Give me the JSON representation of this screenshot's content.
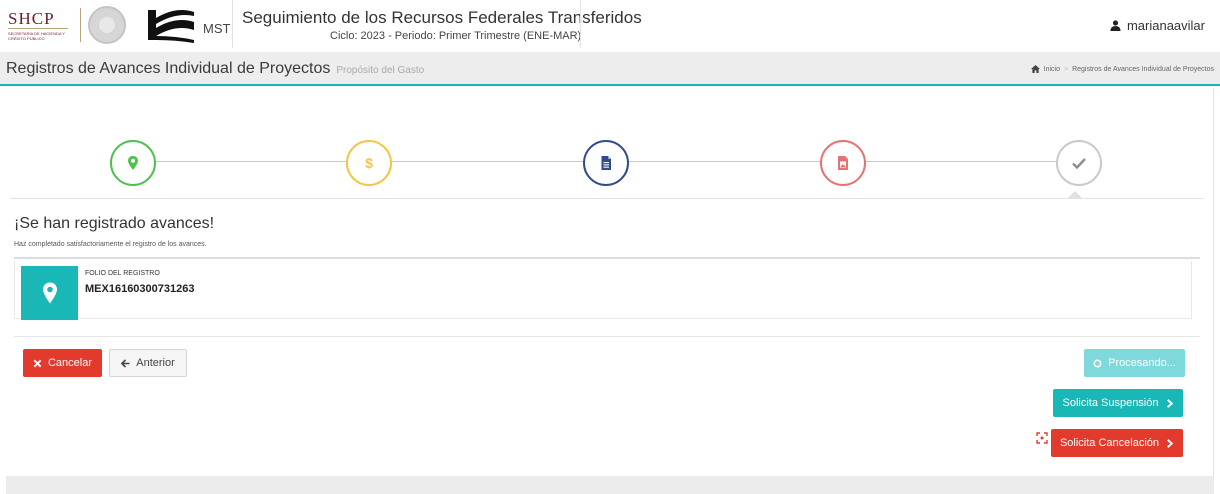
{
  "header": {
    "shcp_logo": {
      "word": "SHCP",
      "sub": "SECRETARÍA DE HACIENDA Y CRÉDITO PÚBLICO"
    },
    "mst_label": "MST",
    "app_title": "Seguimiento de los Recursos Federales Transferidos",
    "cycle": "Ciclo: 2023 - Periodo: Primer Trimestre (ENE-MAR)",
    "username": "marianaavilar"
  },
  "page": {
    "title": "Registros de Avances Individual de Proyectos",
    "subtitle": "Propósito del Gasto",
    "breadcrumb": {
      "home": "Inicio",
      "separator": ">",
      "current": "Registros de Avances Individual de Proyectos"
    }
  },
  "wizard": {
    "steps": [
      {
        "icon": "map-marker-icon",
        "color": "#4cc24c"
      },
      {
        "icon": "dollar-icon",
        "color": "#f5c443"
      },
      {
        "icon": "document-icon",
        "color": "#2e4c8f"
      },
      {
        "icon": "image-icon",
        "color": "#e57373"
      },
      {
        "icon": "check-icon",
        "color": "#9a9a9a",
        "active": true
      }
    ]
  },
  "result": {
    "title": "¡Se han registrado avances!",
    "description": "Haz completado satisfactoriamente el registro de los avances.",
    "folio_label": "FOLIO DEL REGISTRO",
    "folio_value": "MEX16160300731263"
  },
  "actions": {
    "cancel": "Cancelar",
    "previous": "Anterior",
    "processing": "Procesando...",
    "request_suspension": "Solicita Suspensión",
    "request_cancellation": "Solicita Cancelación"
  },
  "colors": {
    "accent": "#1ab7b7",
    "danger": "#e23b2e",
    "processing": "#7fd9dc"
  }
}
